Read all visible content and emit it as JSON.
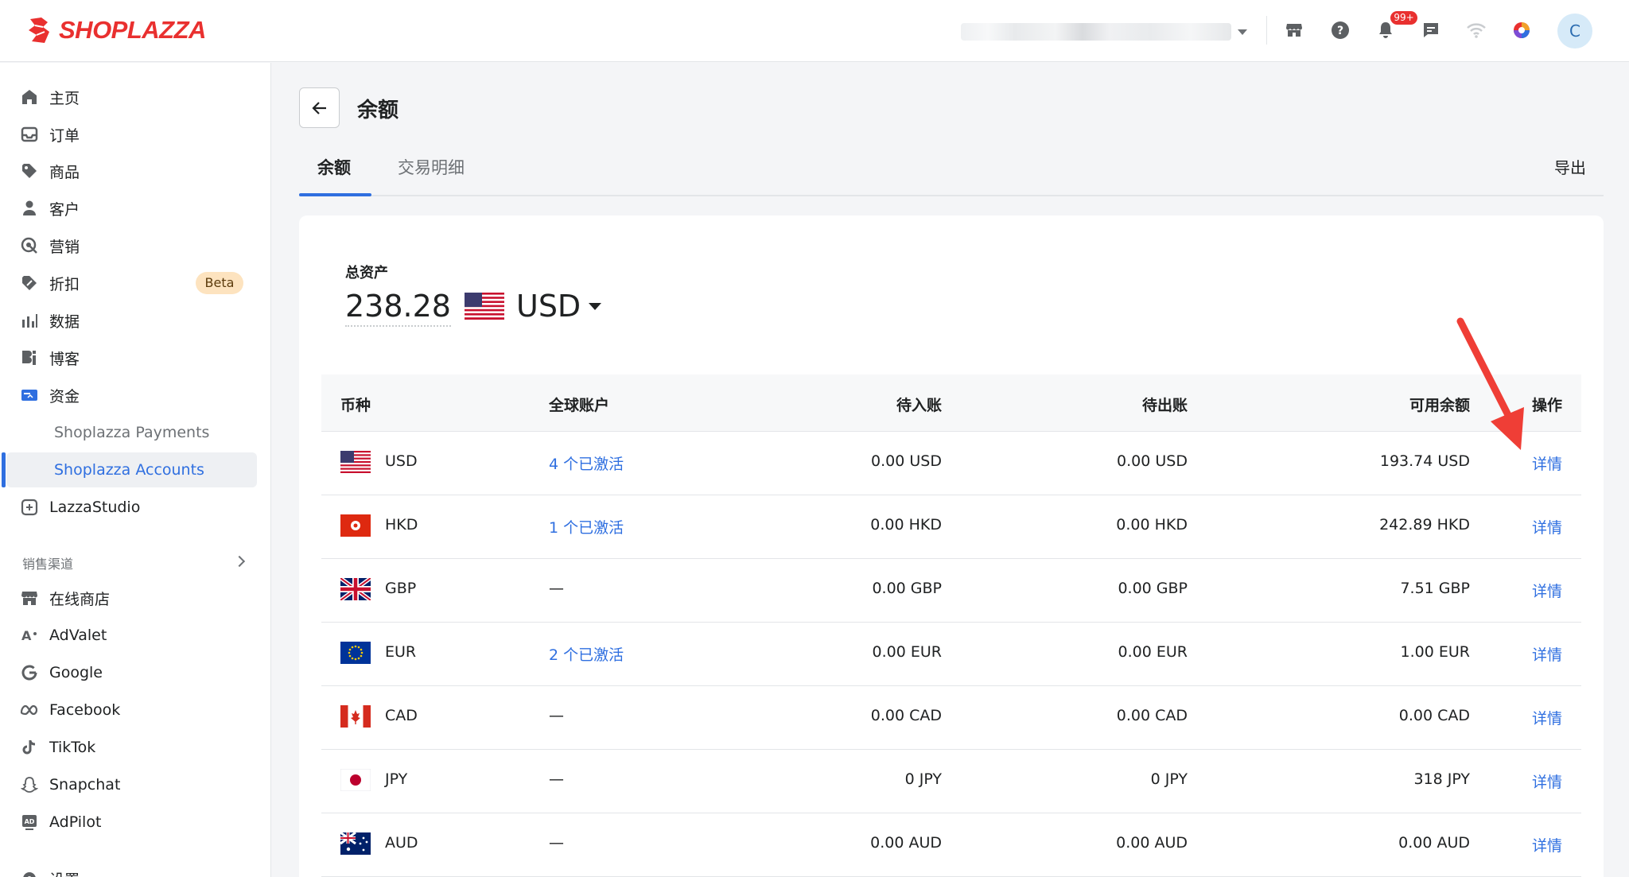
{
  "header": {
    "logo_text": "SHOPLAZZA",
    "notification_count": "99+",
    "avatar_initial": "C",
    "colors": {
      "brand": "#e9302f",
      "accent": "#2f6fe0"
    }
  },
  "sidebar": {
    "items": [
      {
        "label": "主页",
        "icon": "home-icon"
      },
      {
        "label": "订单",
        "icon": "inbox-icon"
      },
      {
        "label": "商品",
        "icon": "tag-icon"
      },
      {
        "label": "客户",
        "icon": "person-icon"
      },
      {
        "label": "营销",
        "icon": "target-icon"
      },
      {
        "label": "折扣",
        "icon": "discount-icon"
      },
      {
        "label": "数据",
        "icon": "bar-chart-icon"
      },
      {
        "label": "博客",
        "icon": "blog-icon"
      },
      {
        "label": "资金",
        "icon": "wallet-icon"
      }
    ],
    "beta_label": "Beta",
    "sub_items": [
      {
        "label": "Shoplazza Payments"
      },
      {
        "label": "Shoplazza Accounts"
      }
    ],
    "lazzastudio": "LazzaStudio",
    "sales_channels_label": "销售渠道",
    "channels": [
      {
        "label": "在线商店",
        "icon": "store-icon"
      },
      {
        "label": "AdValet",
        "icon": "advalet-icon"
      },
      {
        "label": "Google",
        "icon": "google-icon"
      },
      {
        "label": "Facebook",
        "icon": "meta-icon"
      },
      {
        "label": "TikTok",
        "icon": "tiktok-icon"
      },
      {
        "label": "Snapchat",
        "icon": "snapchat-icon"
      },
      {
        "label": "AdPilot",
        "icon": "adpilot-icon"
      }
    ],
    "settings_label": "设置"
  },
  "main": {
    "title": "余额",
    "tabs": [
      {
        "label": "余额"
      },
      {
        "label": "交易明细"
      }
    ],
    "export_label": "导出",
    "total_label": "总资产",
    "total_value": "238.28",
    "total_currency": "USD"
  },
  "table": {
    "headers": [
      "币种",
      "全球账户",
      "待入账",
      "待出账",
      "可用余额",
      "操作"
    ],
    "rows": [
      {
        "currency": "USD",
        "accounts": "4 个已激活",
        "pending_in": "0.00 USD",
        "pending_out": "0.00 USD",
        "available": "193.74 USD",
        "action": "详情"
      },
      {
        "currency": "HKD",
        "accounts": "1 个已激活",
        "pending_in": "0.00 HKD",
        "pending_out": "0.00 HKD",
        "available": "242.89 HKD",
        "action": "详情"
      },
      {
        "currency": "GBP",
        "accounts": "—",
        "pending_in": "0.00 GBP",
        "pending_out": "0.00 GBP",
        "available": "7.51 GBP",
        "action": "详情"
      },
      {
        "currency": "EUR",
        "accounts": "2 个已激活",
        "pending_in": "0.00 EUR",
        "pending_out": "0.00 EUR",
        "available": "1.00 EUR",
        "action": "详情"
      },
      {
        "currency": "CAD",
        "accounts": "—",
        "pending_in": "0.00 CAD",
        "pending_out": "0.00 CAD",
        "available": "0.00 CAD",
        "action": "详情"
      },
      {
        "currency": "JPY",
        "accounts": "—",
        "pending_in": "0 JPY",
        "pending_out": "0 JPY",
        "available": "318 JPY",
        "action": "详情"
      },
      {
        "currency": "AUD",
        "accounts": "—",
        "pending_in": "0.00 AUD",
        "pending_out": "0.00 AUD",
        "available": "0.00 AUD",
        "action": "详情"
      }
    ]
  }
}
